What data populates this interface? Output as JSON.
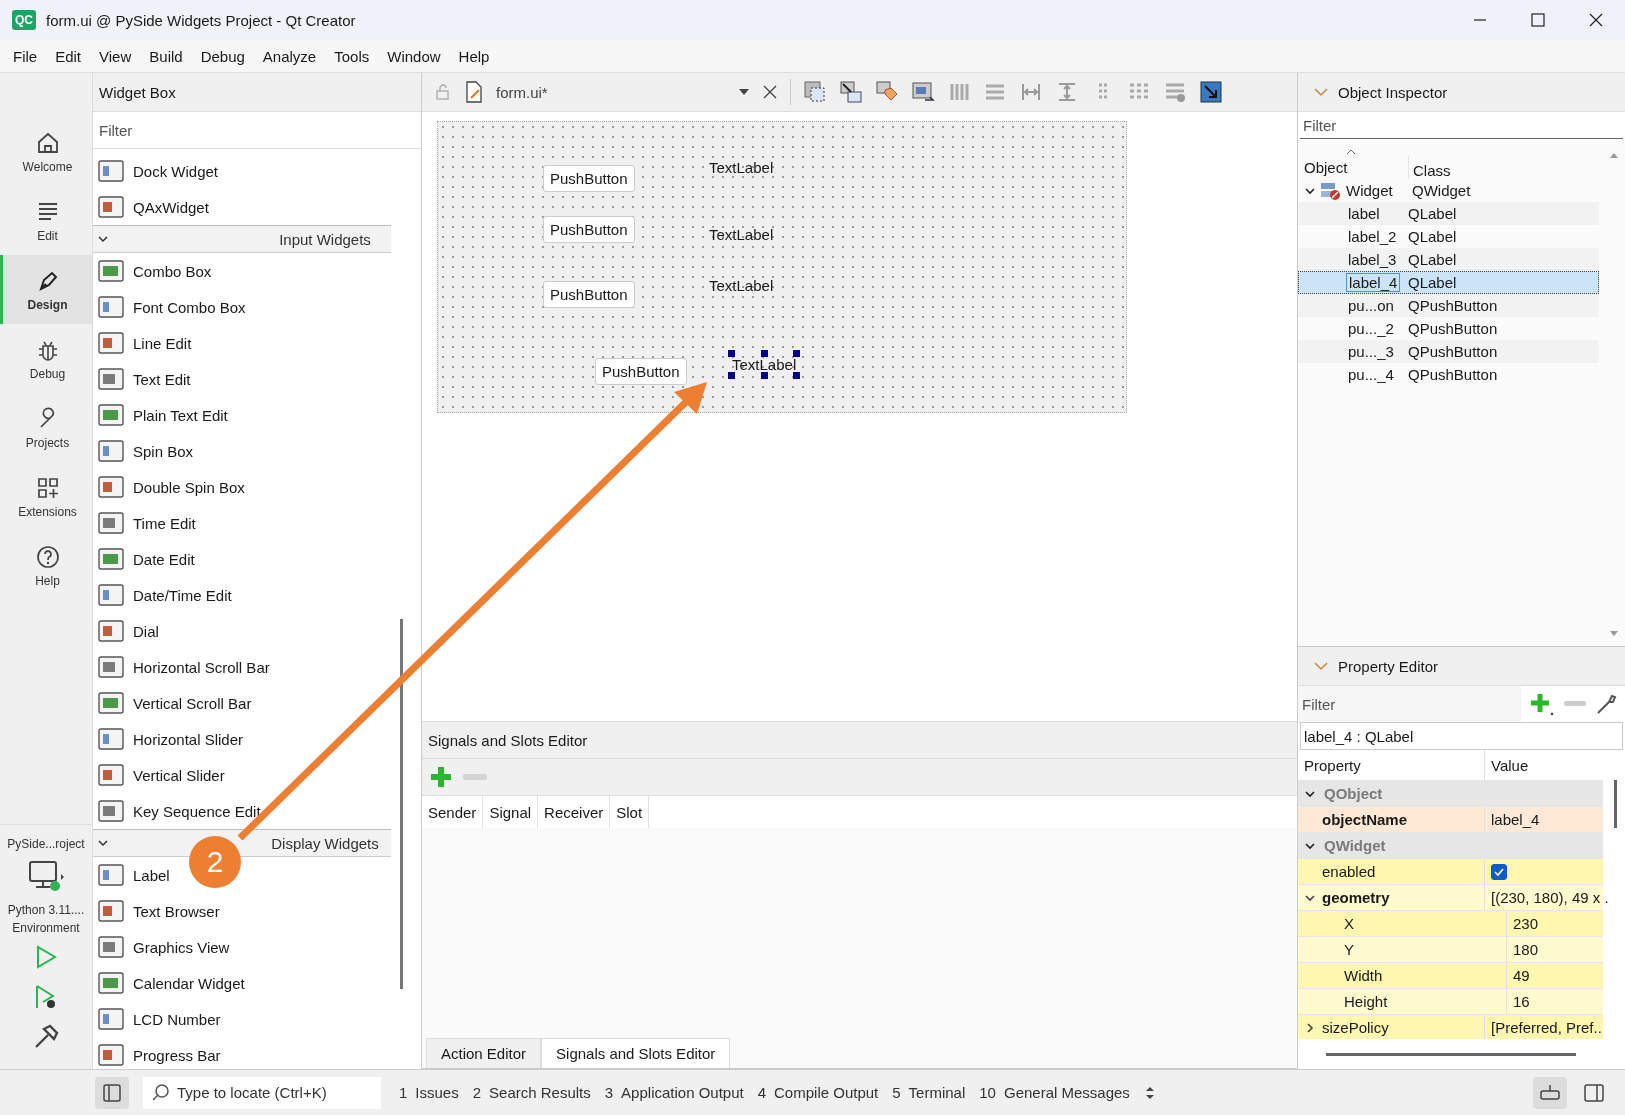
{
  "window": {
    "title": "form.ui @ PySide Widgets Project - Qt Creator",
    "logo": "QC"
  },
  "menu": [
    "File",
    "Edit",
    "View",
    "Build",
    "Debug",
    "Analyze",
    "Tools",
    "Window",
    "Help"
  ],
  "mode_bar": {
    "modes": [
      {
        "label": "Welcome",
        "selected": false
      },
      {
        "label": "Edit",
        "selected": false
      },
      {
        "label": "Design",
        "selected": true
      },
      {
        "label": "Debug",
        "selected": false
      },
      {
        "label": "Projects",
        "selected": false
      },
      {
        "label": "Extensions",
        "selected": false
      },
      {
        "label": "Help",
        "selected": false
      }
    ],
    "project": "PySide...roject",
    "kit": [
      "Python 3.11....",
      "Environment"
    ]
  },
  "widget_box": {
    "title": "Widget Box",
    "filter": {
      "placeholder": "Filter"
    },
    "items": [
      {
        "kind": "widget",
        "label": "Dock Widget"
      },
      {
        "kind": "widget",
        "label": "QAxWidget"
      },
      {
        "kind": "group",
        "label": "Input Widgets",
        "expanded": true
      },
      {
        "kind": "widget",
        "label": "Combo Box"
      },
      {
        "kind": "widget",
        "label": "Font Combo Box"
      },
      {
        "kind": "widget",
        "label": "Line Edit"
      },
      {
        "kind": "widget",
        "label": "Text Edit"
      },
      {
        "kind": "widget",
        "label": "Plain Text Edit"
      },
      {
        "kind": "widget",
        "label": "Spin Box"
      },
      {
        "kind": "widget",
        "label": "Double Spin Box"
      },
      {
        "kind": "widget",
        "label": "Time Edit"
      },
      {
        "kind": "widget",
        "label": "Date Edit"
      },
      {
        "kind": "widget",
        "label": "Date/Time Edit"
      },
      {
        "kind": "widget",
        "label": "Dial"
      },
      {
        "kind": "widget",
        "label": "Horizontal Scroll Bar"
      },
      {
        "kind": "widget",
        "label": "Vertical Scroll Bar"
      },
      {
        "kind": "widget",
        "label": "Horizontal Slider"
      },
      {
        "kind": "widget",
        "label": "Vertical Slider"
      },
      {
        "kind": "widget",
        "label": "Key Sequence Edit"
      },
      {
        "kind": "group",
        "label": "Display Widgets",
        "expanded": true
      },
      {
        "kind": "widget",
        "label": "Label"
      },
      {
        "kind": "widget",
        "label": "Text Browser"
      },
      {
        "kind": "widget",
        "label": "Graphics View"
      },
      {
        "kind": "widget",
        "label": "Calendar Widget"
      },
      {
        "kind": "widget",
        "label": "LCD Number"
      },
      {
        "kind": "widget",
        "label": "Progress Bar"
      }
    ]
  },
  "editor": {
    "file": "form.ui*",
    "form": [
      {
        "kind": "push_button",
        "text": "PushButton",
        "selected": false
      },
      {
        "kind": "label",
        "text": "TextLabel",
        "selected": false
      },
      {
        "kind": "push_button",
        "text": "PushButton",
        "selected": false
      },
      {
        "kind": "label",
        "text": "TextLabel",
        "selected": false
      },
      {
        "kind": "push_button",
        "text": "PushButton",
        "selected": false
      },
      {
        "kind": "label",
        "text": "TextLabel",
        "selected": false
      },
      {
        "kind": "push_button",
        "text": "PushButton",
        "selected": false
      },
      {
        "kind": "label",
        "text": "TextLabel",
        "selected": true
      }
    ]
  },
  "signals_slots": {
    "title": "Signals and Slots Editor",
    "columns": [
      "Sender",
      "Signal",
      "Receiver",
      "Slot"
    ],
    "tabs": [
      {
        "label": "Action Editor",
        "selected": false
      },
      {
        "label": "Signals and Slots Editor",
        "selected": true
      }
    ]
  },
  "object_inspector": {
    "title": "Object Inspector",
    "filter": {
      "placeholder": "Filter"
    },
    "columns": [
      "Object",
      "Class"
    ],
    "tree": [
      {
        "object": "Widget",
        "class": "QWidget",
        "expanded": true,
        "selected": false,
        "children": [
          {
            "object": "label",
            "class": "QLabel",
            "selected": false
          },
          {
            "object": "label_2",
            "class": "QLabel",
            "selected": false
          },
          {
            "object": "label_3",
            "class": "QLabel",
            "selected": false
          },
          {
            "object": "label_4",
            "class": "QLabel",
            "selected": true
          },
          {
            "object": "pu...on",
            "class": "QPushButton",
            "selected": false
          },
          {
            "object": "pu..._2",
            "class": "QPushButton",
            "selected": false
          },
          {
            "object": "pu..._3",
            "class": "QPushButton",
            "selected": false
          },
          {
            "object": "pu..._4",
            "class": "QPushButton",
            "selected": false
          }
        ]
      }
    ]
  },
  "property_editor": {
    "title": "Property Editor",
    "filter": {
      "placeholder": "Filter"
    },
    "object": "label_4 : QLabel",
    "columns": [
      "Property",
      "Value"
    ],
    "groups": [
      {
        "name": "QObject",
        "expanded": true,
        "properties": [
          {
            "kind": "text",
            "name": "objectName",
            "value": "label_4",
            "modified": true
          }
        ]
      },
      {
        "name": "QWidget",
        "expanded": true,
        "properties": [
          {
            "kind": "checkbox",
            "name": "enabled",
            "checked": true,
            "modified": false
          },
          {
            "kind": "text",
            "name": "geometry",
            "value": "[(230, 180), 49 x .",
            "modified": true,
            "expanded": true,
            "children": [
              {
                "name": "X",
                "value": "230"
              },
              {
                "name": "Y",
                "value": "180"
              },
              {
                "name": "Width",
                "value": "49"
              },
              {
                "name": "Height",
                "value": "16"
              }
            ]
          },
          {
            "kind": "text",
            "name": "sizePolicy",
            "value": "[Preferred, Pref..",
            "modified": false,
            "expanded": false
          }
        ]
      }
    ]
  },
  "status_bar": {
    "locate": {
      "placeholder": "Type to locate (Ctrl+K)"
    },
    "panes": [
      {
        "number": "1",
        "label": "Issues"
      },
      {
        "number": "2",
        "label": "Search Results"
      },
      {
        "number": "3",
        "label": "Application Output"
      },
      {
        "number": "4",
        "label": "Compile Output"
      },
      {
        "number": "5",
        "label": "Terminal"
      },
      {
        "number": "10",
        "label": "General Messages"
      }
    ]
  },
  "annotation": {
    "step": "2"
  }
}
